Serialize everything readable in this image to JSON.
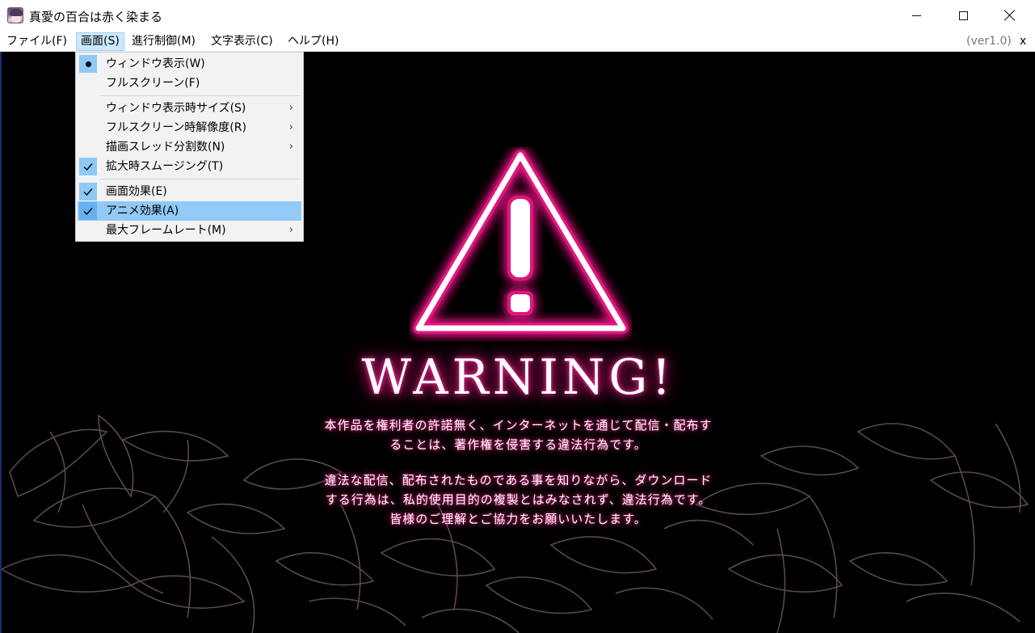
{
  "window": {
    "title": "真愛の百合は赤く染まる",
    "icons": {
      "app": "app-icon",
      "minimize": "minimize-icon",
      "maximize": "maximize-icon",
      "close": "close-icon"
    }
  },
  "menubar": {
    "items": [
      {
        "label": "ファイル(F)"
      },
      {
        "label": "画面(S)",
        "active": true
      },
      {
        "label": "進行制御(M)"
      },
      {
        "label": "文字表示(C)"
      },
      {
        "label": "ヘルプ(H)"
      }
    ],
    "version": "(ver1.0)",
    "close_label": "x"
  },
  "dropdown": {
    "items": [
      {
        "label": "ウィンドウ表示(W)",
        "mark": "bullet"
      },
      {
        "label": "フルスクリーン(F)"
      },
      {
        "label": "ウィンドウ表示時サイズ(S)",
        "submenu": true
      },
      {
        "label": "フルスクリーン時解像度(R)",
        "submenu": true
      },
      {
        "label": "描画スレッド分割数(N)",
        "submenu": true
      },
      {
        "label": "拡大時スムージング(T)",
        "mark": "check"
      },
      {
        "label": "画面効果(E)",
        "mark": "check"
      },
      {
        "label": "アニメ効果(A)",
        "mark": "check",
        "highlighted": true
      },
      {
        "label": "最大フレームレート(M)",
        "submenu": true
      }
    ],
    "submenu_arrow": "›"
  },
  "game": {
    "warning_title": "WARNING!",
    "notice_lines_1": [
      "本作品を権利者の許諾無く、インターネットを通じて配信・配布す",
      "ることは、著作権を侵害する違法行為です。"
    ],
    "notice_lines_2": [
      "違法な配信、配布されたものである事を知りながら、ダウンロード",
      "する行為は、私的使用目的の複製とはみなされず、違法行為です。",
      "皆様のご理解とご協力をお願いいたします。"
    ],
    "colors": {
      "glow": "#e0147e",
      "background": "#000000",
      "lily_outline": "#6b5560"
    },
    "icons": {
      "warning": "warning-triangle-icon",
      "background": "lily-flowers-icon"
    }
  }
}
